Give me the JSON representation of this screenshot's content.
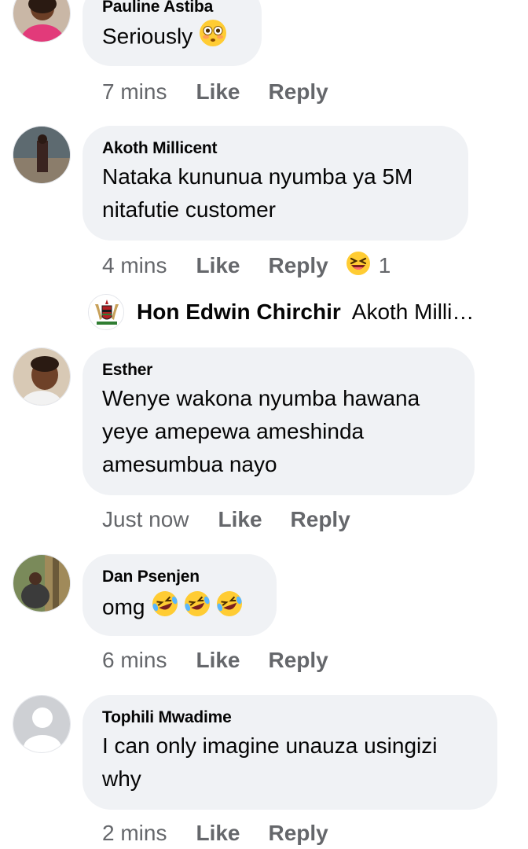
{
  "comments": [
    {
      "author": "Pauline Astiba",
      "text": "Seriously",
      "emoji": "flushed-face-emoji",
      "time": "7 mins",
      "like_label": "Like",
      "reply_label": "Reply"
    },
    {
      "author": "Akoth Millicent",
      "text_line1": "Nataka kununua nyumba ya 5M",
      "text_line2": "nitafutie customer",
      "time": "4 mins",
      "like_label": "Like",
      "reply_label": "Reply",
      "reaction_emoji": "laughing-squint-emoji",
      "reaction_count": "1"
    },
    {
      "author": "Esther",
      "text_line1": "Wenye wakona nyumba hawana",
      "text_line2": "yeye amepewa ameshinda",
      "text_line3": "amesumbua nayo",
      "time": "Just now",
      "like_label": "Like",
      "reply_label": "Reply"
    },
    {
      "author": "Dan Psenjen",
      "text": "omg",
      "emoji": "rolling-on-floor-laughing-emoji",
      "time": "6 mins",
      "like_label": "Like",
      "reply_label": "Reply"
    },
    {
      "author": "Tophili Mwadime",
      "text_line1": "I can only imagine unauza usingizi",
      "text_line2": "why",
      "time": "2 mins",
      "like_label": "Like",
      "reply_label": "Reply"
    }
  ],
  "reply_preview": {
    "author": "Hon Edwin Chirchir",
    "text": "Akoth Milli…",
    "avatar": "coat-of-arms-avatar"
  },
  "colors": {
    "bubble": "#f0f2f5",
    "meta_text": "#65676b",
    "text": "#050505"
  }
}
